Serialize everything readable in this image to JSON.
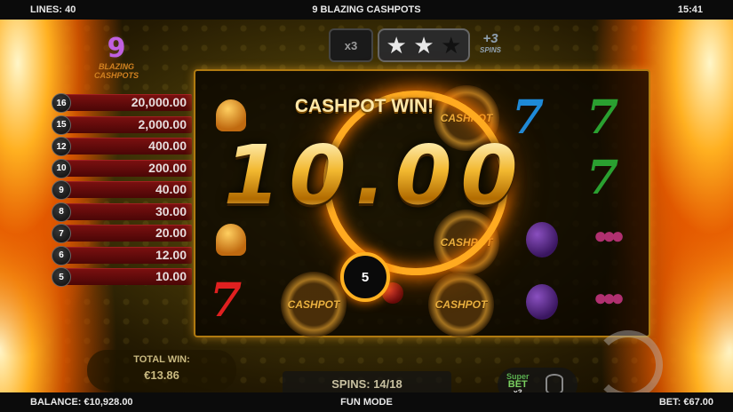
{
  "topbar": {
    "lines": "LINES: 40",
    "title": "9 BLAZING CASHPOTS",
    "clock": "15:41"
  },
  "bottombar": {
    "balance": "BALANCE: €10,928.00",
    "mode": "FUN MODE",
    "bet": "BET: €67.00"
  },
  "logo": {
    "number": "9",
    "line1": "BLAZING",
    "line2": "CASHPOTS"
  },
  "paytable": [
    {
      "count": "16",
      "value": "20,000.00"
    },
    {
      "count": "15",
      "value": "2,000.00"
    },
    {
      "count": "12",
      "value": "400.00"
    },
    {
      "count": "10",
      "value": "200.00"
    },
    {
      "count": "9",
      "value": "40.00"
    },
    {
      "count": "8",
      "value": "30.00"
    },
    {
      "count": "7",
      "value": "20.00"
    },
    {
      "count": "6",
      "value": "12.00"
    },
    {
      "count": "5",
      "value": "10.00"
    }
  ],
  "indicators": {
    "multiplier": "x3",
    "stars_filled": 2,
    "stars_total": 3,
    "bonus_spins": "+3",
    "bonus_spins_label": "SPINS"
  },
  "win": {
    "title": "CASHPOT WIN!",
    "amount": "10.00",
    "countdown": "5"
  },
  "symbols": {
    "cashpot_label": "CASHPOT",
    "seven": "7"
  },
  "panels": {
    "total_win_label": "TOTAL WIN:",
    "total_win_amount": "€13.86",
    "spins": "SPINS: 14/18",
    "superbet_line1": "Super",
    "superbet_line2": "BET",
    "superbet_multiplier": "x3"
  },
  "colors": {
    "accent_gold": "#ffb020",
    "paytable_red": "#7a1010",
    "seven_red": "#e02020",
    "seven_green": "#2aa030",
    "seven_blue": "#1e8ad8"
  }
}
